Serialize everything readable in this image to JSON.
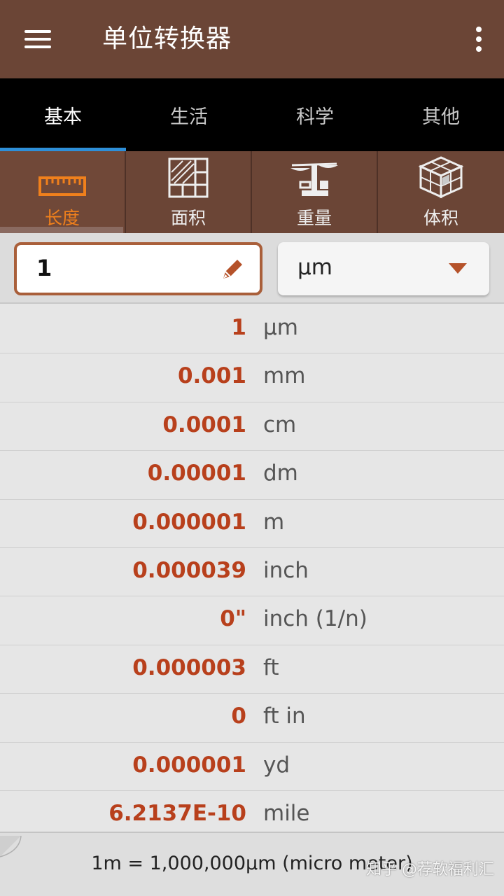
{
  "app": {
    "title": "单位转换器"
  },
  "tabs": [
    {
      "label": "基本",
      "active": true
    },
    {
      "label": "生活",
      "active": false
    },
    {
      "label": "科学",
      "active": false
    },
    {
      "label": "其他",
      "active": false
    }
  ],
  "categories": [
    {
      "label": "长度",
      "icon": "ruler-icon",
      "active": true
    },
    {
      "label": "面积",
      "icon": "area-grid-icon",
      "active": false
    },
    {
      "label": "重量",
      "icon": "scale-icon",
      "active": false
    },
    {
      "label": "体积",
      "icon": "cube-icon",
      "active": false
    }
  ],
  "input": {
    "value": "1",
    "unit": "μm"
  },
  "results": [
    {
      "value": "1",
      "unit": "μm"
    },
    {
      "value": "0.001",
      "unit": "mm"
    },
    {
      "value": "0.0001",
      "unit": "cm"
    },
    {
      "value": "0.00001",
      "unit": "dm"
    },
    {
      "value": "0.000001",
      "unit": "m"
    },
    {
      "value": "0.000039",
      "unit": "inch"
    },
    {
      "value": "0\"",
      "unit": "inch (1/n)"
    },
    {
      "value": "0.000003",
      "unit": "ft"
    },
    {
      "value": "0",
      "unit": "ft in"
    },
    {
      "value": "0.000001",
      "unit": "yd"
    },
    {
      "value": "6.2137E-10",
      "unit": "mile"
    }
  ],
  "footer": {
    "definition": "1m = 1,000,000μm (micro meter)",
    "watermark": "知乎 @荐软福利汇"
  },
  "colors": {
    "toolbar": "#6b4536",
    "accent_orange": "#f0801c",
    "value_red": "#b8401c",
    "tab_indicator": "#2e8fd8"
  }
}
